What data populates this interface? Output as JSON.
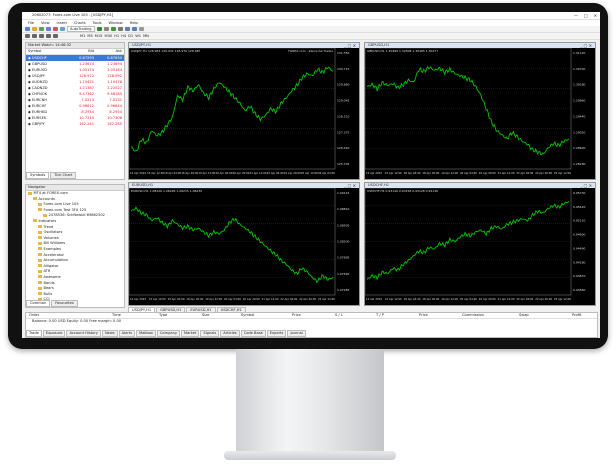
{
  "window": {
    "title": "20602077: Forex.com Live 105 - [USDJPY,H1]",
    "controls": [
      "—",
      "□",
      "✕"
    ]
  },
  "menu": [
    "File",
    "View",
    "Insert",
    "Charts",
    "Tools",
    "Window",
    "Help"
  ],
  "toolbar": {
    "autotrading_label": "AutoTrading",
    "timeframes": [
      "M1",
      "M5",
      "M15",
      "M30",
      "H1",
      "H4",
      "D1",
      "W1",
      "MN"
    ]
  },
  "market_watch": {
    "title": "Market Watch: 14:46:32",
    "headers": {
      "symbol": "Symbol",
      "bid": "Bid",
      "ask": "Ask"
    },
    "rows": [
      {
        "symbol": "USDCHF",
        "bid": "0.87593",
        "ask": "0.87630",
        "selected": true
      },
      {
        "symbol": "GBPUSD",
        "bid": "1.23674",
        "ask": "1.23694",
        "selected": false
      },
      {
        "symbol": "EURUSD",
        "bid": "1.05174",
        "ask": "1.05184",
        "selected": false
      },
      {
        "symbol": "USDJPY",
        "bid": "128.972",
        "ask": "128.992",
        "selected": false
      },
      {
        "symbol": "AUDNZD",
        "bid": "1.10421",
        "ask": "1.10478",
        "selected": false
      },
      {
        "symbol": "CADNZD",
        "bid": "1.21387",
        "ask": "1.22027",
        "selected": false
      },
      {
        "symbol": "CHFNOK",
        "bid": "9.47362",
        "ask": "9.48185",
        "selected": false
      },
      {
        "symbol": "EURCNH",
        "bid": "7.0213",
        "ask": "7.0231",
        "selected": false
      },
      {
        "symbol": "EURCHF",
        "bid": "0.96612",
        "ask": "0.96644",
        "selected": false
      },
      {
        "symbol": "EURHKD",
        "bid": "8.2934",
        "ask": "8.2954",
        "selected": false
      },
      {
        "symbol": "EURSEK",
        "bid": "10.7215",
        "ask": "10.7306",
        "selected": false
      },
      {
        "symbol": "GBPJPY",
        "bid": "162.241",
        "ask": "162.285",
        "selected": false
      }
    ],
    "tabs": [
      "Symbols",
      "Tick Chart"
    ]
  },
  "navigator": {
    "title": "Navigator",
    "items": [
      {
        "label": "MT4 at FOREX.com",
        "depth": 0
      },
      {
        "label": "Accounts",
        "depth": 1
      },
      {
        "label": "Forex.com Live 105",
        "depth": 2
      },
      {
        "label": "Forex.com Test 3FX 125",
        "depth": 2
      },
      {
        "label": "2478536: SchNewbil 69862502",
        "depth": 3
      },
      {
        "label": "Indicators",
        "depth": 1
      },
      {
        "label": "Trend",
        "depth": 2
      },
      {
        "label": "Oscillators",
        "depth": 2
      },
      {
        "label": "Volumes",
        "depth": 2
      },
      {
        "label": "Bill Williams",
        "depth": 2
      },
      {
        "label": "Examples",
        "depth": 2
      },
      {
        "label": "Accelerator",
        "depth": 2
      },
      {
        "label": "Accumulation",
        "depth": 2
      },
      {
        "label": "Alligator",
        "depth": 2
      },
      {
        "label": "ATR",
        "depth": 2
      },
      {
        "label": "Awesome",
        "depth": 2
      },
      {
        "label": "Bands",
        "depth": 2
      },
      {
        "label": "Bears",
        "depth": 2
      },
      {
        "label": "Bulls",
        "depth": 2
      },
      {
        "label": "CCI",
        "depth": 2
      }
    ],
    "tabs": [
      "Common",
      "Favourites"
    ]
  },
  "charts": [
    {
      "title": "USDJPY,H1",
      "info": "USDJPY,H1 128.983 129.031 128.970 128.987",
      "watermark": "FOREX.com - Zenniche Trader",
      "price_labels": [
        "131.550",
        "130.715",
        "129.880",
        "129.045",
        "128.210",
        "127.375",
        "126.540",
        "125.705"
      ],
      "time_labels": [
        "14 Apr 2022",
        "15 Apr 12:00",
        "18 Apr 04:00",
        "18 Apr 20:00",
        "19 Apr 12:00",
        "20 Apr 04:00",
        "20 Apr 20:00",
        "21 Apr 12:00",
        "22 Apr 04:00",
        "22 Apr 20:00",
        "25 Apr 12:00",
        "26 Apr 04:00"
      ],
      "series": [
        0.15,
        0.1,
        0.22,
        0.18,
        0.3,
        0.25,
        0.28,
        0.35,
        0.42,
        0.62,
        0.58,
        0.7,
        0.66,
        0.72,
        0.64,
        0.6,
        0.68,
        0.74,
        0.7,
        0.65,
        0.6,
        0.55,
        0.48,
        0.52,
        0.45,
        0.4,
        0.44,
        0.5,
        0.47,
        0.55,
        0.6,
        0.66,
        0.71,
        0.78,
        0.82,
        0.8,
        0.86,
        0.83,
        0.88,
        0.84
      ]
    },
    {
      "title": "GBPUSD,H1",
      "info": "GBPUSD,H1 1.30489 1.30508 1.30465 1.30477",
      "price_labels": [
        "1.31120",
        "1.30700",
        "1.30280",
        "1.29860",
        "1.29440",
        "1.29020",
        "1.28600",
        "1.28180"
      ],
      "time_labels": [
        "14 Apr 2022",
        "15 Apr 12:00",
        "18 Apr 04:00",
        "18 Apr 20:00",
        "19 Apr 12:00",
        "20 Apr 04:00",
        "20 Apr 20:00",
        "21 Apr 12:00",
        "22 Apr 04:00",
        "22 Apr 20:00",
        "25 Apr 12:00"
      ],
      "series": [
        0.7,
        0.72,
        0.68,
        0.74,
        0.71,
        0.73,
        0.69,
        0.72,
        0.76,
        0.74,
        0.86,
        0.84,
        0.88,
        0.85,
        0.87,
        0.83,
        0.86,
        0.82,
        0.8,
        0.78,
        0.76,
        0.7,
        0.62,
        0.5,
        0.38,
        0.3,
        0.26,
        0.22,
        0.28,
        0.24,
        0.2,
        0.17,
        0.12,
        0.1,
        0.08,
        0.14,
        0.18,
        0.16,
        0.2,
        0.22
      ]
    },
    {
      "title": "EURUSD,H1",
      "info": "EURUSD,H1 1.08226 1.08248 1.08215 1.08230",
      "price_labels": [
        "1.09115",
        "1.08810",
        "1.08505",
        "1.08200",
        "1.07895",
        "1.07590",
        "1.07285"
      ],
      "time_labels": [
        "14 Apr 2022",
        "15 Apr 12:00",
        "18 Apr 04:00",
        "18 Apr 20:00",
        "19 Apr 12:00",
        "20 Apr 04:00",
        "20 Apr 20:00",
        "21 Apr 12:00",
        "22 Apr 04:00",
        "22 Apr 20:00",
        "25 Apr 12:00"
      ],
      "series": [
        0.82,
        0.85,
        0.8,
        0.78,
        0.72,
        0.75,
        0.7,
        0.66,
        0.72,
        0.68,
        0.64,
        0.66,
        0.62,
        0.64,
        0.6,
        0.56,
        0.6,
        0.58,
        0.62,
        0.7,
        0.74,
        0.68,
        0.64,
        0.6,
        0.55,
        0.5,
        0.45,
        0.4,
        0.36,
        0.3,
        0.26,
        0.2,
        0.16,
        0.22,
        0.18,
        0.12,
        0.08,
        0.14,
        0.1,
        0.12
      ]
    },
    {
      "title": "USDCHF,H1",
      "info": "USDCHF,H1 0.93149 0.93158 0.93128 0.93136",
      "price_labels": [
        "0.95730",
        "0.95420",
        "0.95110",
        "0.94800",
        "0.94490",
        "0.94180",
        "0.93870",
        "0.93560"
      ],
      "time_labels": [
        "14 Apr 2022",
        "15 Apr 12:00",
        "18 Apr 04:00",
        "18 Apr 20:00",
        "19 Apr 12:00",
        "20 Apr 04:00",
        "20 Apr 20:00",
        "21 Apr 12:00",
        "22 Apr 04:00",
        "22 Apr 20:00",
        "25 Apr 12:00"
      ],
      "series": [
        0.1,
        0.14,
        0.12,
        0.18,
        0.16,
        0.22,
        0.2,
        0.26,
        0.3,
        0.35,
        0.4,
        0.38,
        0.44,
        0.42,
        0.48,
        0.46,
        0.52,
        0.5,
        0.55,
        0.58,
        0.56,
        0.6,
        0.62,
        0.58,
        0.64,
        0.66,
        0.63,
        0.68,
        0.7,
        0.72,
        0.74,
        0.72,
        0.78,
        0.82,
        0.8,
        0.85,
        0.88,
        0.86,
        0.9,
        0.92
      ]
    }
  ],
  "chart_tabs": [
    "USDJPY,H1",
    "GBPUSD,H1",
    "EURUSD,H1",
    "USDCHF,H1"
  ],
  "terminal": {
    "headers": [
      "Order",
      "Time",
      "Type",
      "Size",
      "Symbol",
      "Price",
      "S / L",
      "T / P",
      "Price",
      "Commission",
      "Swap",
      "Profit"
    ],
    "balance": "Balance: 0.00 USD  Equity: 0.00  Free margin: 0.00",
    "tabs": [
      "Trade",
      "Exposure",
      "Account History",
      "News",
      "Alerts",
      "Mailbox",
      "Company",
      "Market",
      "Signals",
      "Articles",
      "Code Base",
      "Experts",
      "Journal"
    ]
  },
  "colors": {
    "chart_bg": "#000000",
    "chart_line": "#00c800",
    "grid": "#2e4a2e",
    "selected_row": "#3b78d8",
    "price_text": "#d22233"
  }
}
